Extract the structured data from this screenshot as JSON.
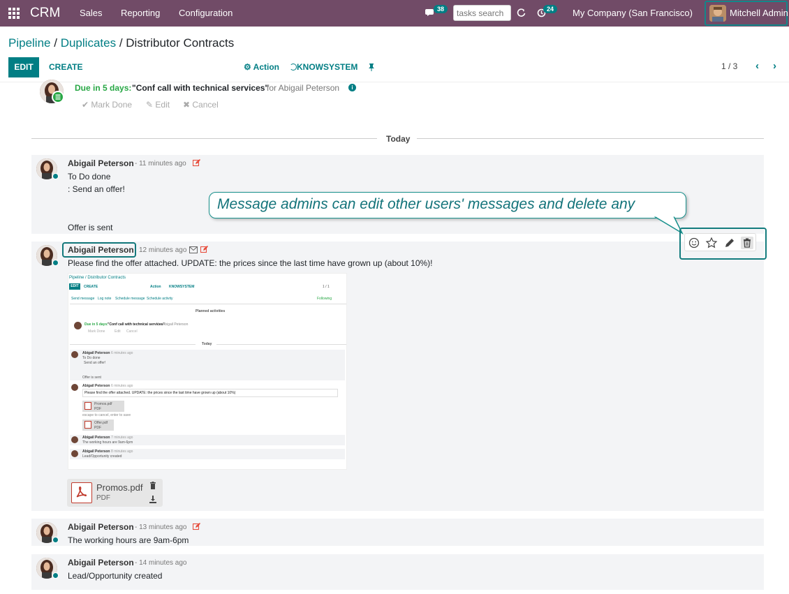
{
  "topbar": {
    "brand": "CRM",
    "menu": [
      "Sales",
      "Reporting",
      "Configuration"
    ],
    "chat_badge": "38",
    "search_placeholder": "tasks search",
    "activity_badge": "24",
    "company": "My Company (San Francisco)",
    "user": "Mitchell Admin"
  },
  "breadcrumb": {
    "root": "Pipeline",
    "sep": "/",
    "mid": "Duplicates",
    "current": "Distributor Contracts"
  },
  "controls": {
    "edit": "EDIT",
    "create": "CREATE",
    "action": "Action",
    "knowsystem": "KNOWSYSTEM",
    "pager": "1 / 3"
  },
  "activity": {
    "due": "Due in 5 days:",
    "title": "\"Conf call with technical services\"",
    "for": "for Abigail Peterson",
    "mark_done": "Mark Done",
    "edit": "Edit",
    "cancel": "Cancel"
  },
  "separator": "Today",
  "callout": "Message admins can edit other users' messages and delete any",
  "messages": [
    {
      "author": "Abigail Peterson",
      "ago": "- 11 minutes ago",
      "lines": [
        "To Do done",
        ": Send an offer!",
        "Offer is sent"
      ]
    },
    {
      "author": "Abigail Peterson",
      "ago": "12 minutes ago",
      "body": "Please find the offer attached. UPDATE: the prices since the last time have grown up (about 10%)!",
      "attachment": {
        "name": "Promos.pdf",
        "type": "PDF"
      }
    },
    {
      "author": "Abigail Peterson",
      "ago": "- 13 minutes ago",
      "body": "The working hours are 9am-6pm"
    },
    {
      "author": "Abigail Peterson",
      "ago": "- 14 minutes ago",
      "body": "Lead/Opportunity created"
    }
  ],
  "screenshot": {
    "crumbs": "Pipeline / Distributor Contracts",
    "edit": "EDIT",
    "create": "CREATE",
    "action": "Action",
    "knowsystem": "KNOWSYSTEM",
    "pager": "1 / 1",
    "send": "Send message",
    "log": "Log note",
    "schedule_msg": "Schedule message",
    "schedule_act": "Schedule activity",
    "following": "Following",
    "planned": "Planned activities",
    "due": "Due in 5 days:",
    "title": "\"Conf call with technical services\"",
    "for": "for Abigail Peterson",
    "mark_done": "Mark Done",
    "edit_link": "Edit",
    "cancel": "Cancel",
    "today": "Today",
    "author": "Abigail Peterson",
    "ago1": "- 6 minutes ago",
    "todo": "To Do done",
    "send_offer": "Send an offer!",
    "offer_sent": "Offer is sent",
    "ago2": "- 6 minutes ago",
    "body2": "Please find the offer attached.  UPDATE: the prices since the last time have grown up (about 10%)",
    "promos": "Promos.pdf",
    "pdf": "PDF",
    "escape": "escape to cancel, enter to save",
    "offer": "Offer.pdf",
    "ago3": "- 7 minutes ago",
    "hours": "The working hours are 9am-6pm",
    "ago4": "- 8 minutes ago",
    "created": "Lead/Opportunity created"
  }
}
